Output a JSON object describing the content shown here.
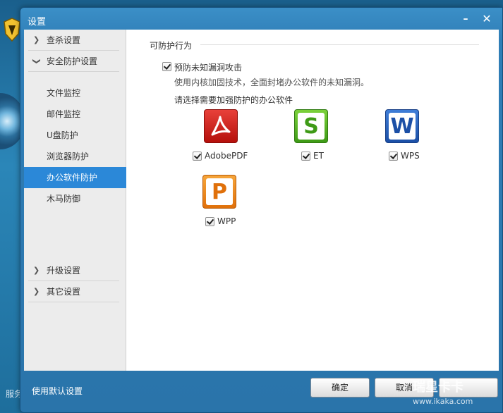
{
  "window": {
    "title": "设置"
  },
  "sidebar": {
    "groups": [
      {
        "label": "查杀设置"
      },
      {
        "label": "安全防护设置"
      }
    ],
    "items": [
      {
        "label": "文件监控"
      },
      {
        "label": "邮件监控"
      },
      {
        "label": "U盘防护"
      },
      {
        "label": "浏览器防护"
      },
      {
        "label": "办公软件防护"
      },
      {
        "label": "木马防御"
      }
    ],
    "bottom_groups": [
      {
        "label": "升级设置"
      },
      {
        "label": "其它设置"
      }
    ],
    "active_item": "办公软件防护"
  },
  "main": {
    "section_title": "可防护行为",
    "option": {
      "label": "预防未知漏洞攻击",
      "checked": true,
      "description": "使用内核加固技术，全面封堵办公软件的未知漏洞。"
    },
    "apps_prompt": "请选择需要加强防护的办公软件",
    "apps": [
      {
        "label": "AdobePDF",
        "icon": "adobe-pdf-icon",
        "checked": true,
        "color": "#c4161c"
      },
      {
        "label": "ET",
        "icon": "et-spreadsheet-icon",
        "checked": true,
        "color": "#4caf1a"
      },
      {
        "label": "WPS",
        "icon": "wps-writer-icon",
        "checked": true,
        "color": "#1e56b0"
      },
      {
        "label": "WPP",
        "icon": "wpp-presentation-icon",
        "checked": true,
        "color": "#ee8a1c"
      }
    ]
  },
  "footer": {
    "default_link": "使用默认设置",
    "ok_label": "确定",
    "cancel_label": "取消"
  },
  "background": {
    "partial_text": "服务"
  },
  "watermark": {
    "line1": "瑞星卡卡",
    "line2": "www.ikaka.com"
  },
  "colors": {
    "accent": "#2b88d8",
    "title_bar": "#2f7eb7"
  }
}
